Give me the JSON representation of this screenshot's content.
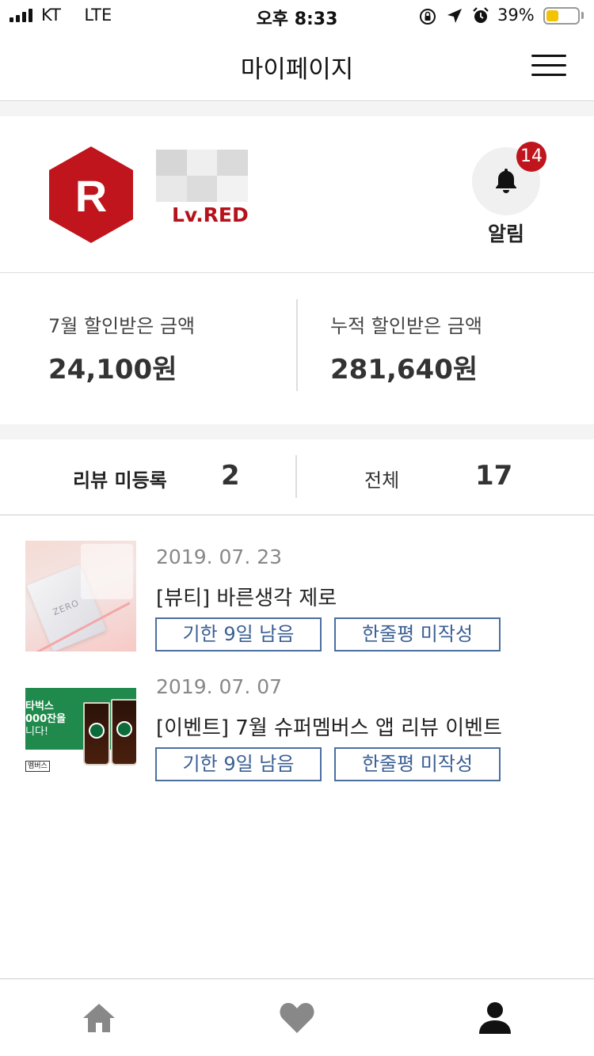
{
  "status_bar": {
    "carrier": "KT",
    "network": "LTE",
    "time": "오후 8:33",
    "battery_percent": "39%",
    "battery_level": 0.39
  },
  "header": {
    "title": "마이페이지",
    "menu_icon": "hamburger-menu-icon"
  },
  "profile": {
    "logo_letter": "R",
    "level": "Lv.RED",
    "brand_color": "#c0151d",
    "notification": {
      "count": "14",
      "label": "알림",
      "icon": "bell-icon"
    }
  },
  "discount_summary": {
    "monthly": {
      "label": "7월 할인받은 금액",
      "value": "24,100원"
    },
    "cumulative": {
      "label": "누적 할인받은 금액",
      "value": "281,640원"
    }
  },
  "review_counts": {
    "unregistered": {
      "label": "리뷰 미등록",
      "value": "2"
    },
    "total": {
      "label": "전체",
      "value": "17"
    }
  },
  "items": [
    {
      "date": "2019. 07. 23",
      "title": "[뷰티] 바른생각 제로",
      "tags": [
        "기한 9일 남음",
        "한줄평 미작성"
      ],
      "thumb_text": "ZERO"
    },
    {
      "date": "2019. 07. 07",
      "title": "[이벤트] 7월 슈퍼멤버스 앱 리뷰 이벤트",
      "tags": [
        "기한 9일 남음",
        "한줄평 미작성"
      ],
      "thumb_lines": [
        "타벅스",
        "000잔을",
        "니다!"
      ],
      "thumb_badge": "멤버스"
    }
  ],
  "tab_bar": {
    "icons": [
      "home-icon",
      "heart-icon",
      "person-icon"
    ]
  },
  "colors": {
    "tag_border": "#4a6fa0",
    "level_text": "#b5121b",
    "starbucks_green": "#1f8a4c"
  }
}
